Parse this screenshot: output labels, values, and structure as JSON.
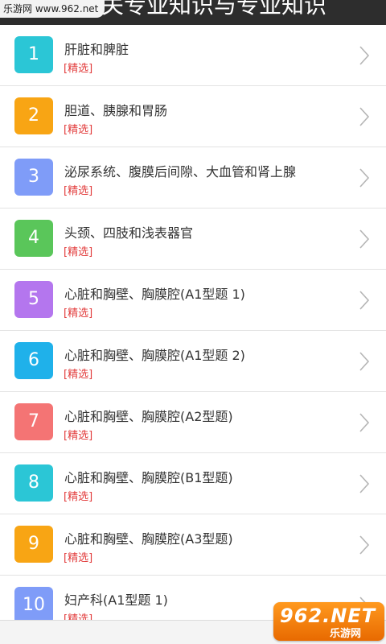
{
  "header": {
    "title": "相关专业知识与专业知识"
  },
  "watermark_tag": "乐游网 www.962.net",
  "logo": {
    "main": "962.NET",
    "sub": "乐游网"
  },
  "items": [
    {
      "number": "1",
      "title": "肝脏和脾脏",
      "tag": "[精选]",
      "color": "#2bc6d6"
    },
    {
      "number": "2",
      "title": "胆道、胰腺和胃肠",
      "tag": "[精选]",
      "color": "#f8a514"
    },
    {
      "number": "3",
      "title": "泌尿系统、腹膜后间隙、大血管和肾上腺",
      "tag": "[精选]",
      "color": "#7f9cf8"
    },
    {
      "number": "4",
      "title": "头颈、四肢和浅表器官",
      "tag": "[精选]",
      "color": "#5ac65a"
    },
    {
      "number": "5",
      "title": "心脏和胸壁、胸膜腔(A1型题 1)",
      "tag": "[精选]",
      "color": "#b476ee"
    },
    {
      "number": "6",
      "title": "心脏和胸壁、胸膜腔(A1型题 2)",
      "tag": "[精选]",
      "color": "#1fb1ea"
    },
    {
      "number": "7",
      "title": "心脏和胸壁、胸膜腔(A2型题)",
      "tag": "[精选]",
      "color": "#f47474"
    },
    {
      "number": "8",
      "title": "心脏和胸壁、胸膜腔(B1型题)",
      "tag": "[精选]",
      "color": "#2bc6d6"
    },
    {
      "number": "9",
      "title": "心脏和胸壁、胸膜腔(A3型题)",
      "tag": "[精选]",
      "color": "#f8a514"
    },
    {
      "number": "10",
      "title": "妇产科(A1型题 1)",
      "tag": "[精选]",
      "color": "#7f9cf8"
    }
  ]
}
